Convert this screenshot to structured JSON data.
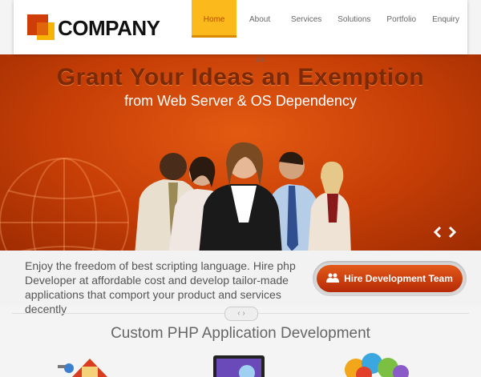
{
  "header": {
    "logo_text": "COMPANY",
    "nav": [
      {
        "label": "Home",
        "active": true
      },
      {
        "label": "About us",
        "active": false
      },
      {
        "label": "Services",
        "active": false
      },
      {
        "label": "Solutions",
        "active": false
      },
      {
        "label": "Portfolio",
        "active": false
      },
      {
        "label": "Enquiry",
        "active": false
      }
    ]
  },
  "hero": {
    "title": "Grant Your Ideas an Exemption",
    "subtitle": "from Web Server & OS Dependency",
    "prev_icon": "chevron-left-icon",
    "next_icon": "chevron-right-icon"
  },
  "intro": {
    "text": "Enjoy the freedom of best scripting language. Hire php Developer at affordable cost and develop tailor-made applications that comport your product and services decently",
    "hire_button": "Hire Development Team"
  },
  "section": {
    "title": "Custom PHP Application Development"
  },
  "colors": {
    "accent_orange": "#c63e06",
    "nav_active": "#fbb91c",
    "logo_red": "#cf3d08"
  }
}
